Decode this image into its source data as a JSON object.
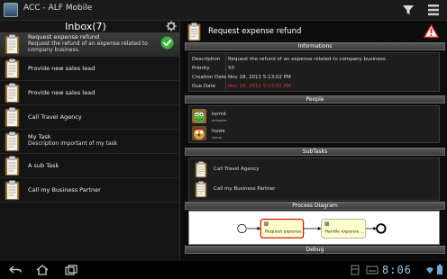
{
  "app": {
    "title": "ACC - ALF Mobile"
  },
  "inbox": {
    "title": "Inbox(7)",
    "tasks": [
      {
        "title": "Request expense refund",
        "desc": "Request the refund of an expense related to company business."
      },
      {
        "title": "Provide new sales lead",
        "desc": ""
      },
      {
        "title": "Provide new sales lead",
        "desc": ""
      },
      {
        "title": "Call Travel Agency",
        "desc": ""
      },
      {
        "title": "My Task",
        "desc": "Description important of my task"
      },
      {
        "title": "A sub Task",
        "desc": ""
      },
      {
        "title": "Call my Business Partner",
        "desc": ""
      }
    ]
  },
  "detail": {
    "title": "Request expense refund",
    "sections": {
      "informations": "Informations",
      "people": "People",
      "subtasks": "SubTasks",
      "process": "Process Diagram",
      "debug": "Debug"
    },
    "info": [
      {
        "label": "Description",
        "value": "Request the refund of an expense related to company business."
      },
      {
        "label": "Priority",
        "value": "50"
      },
      {
        "label": "Creation Date",
        "value": "Nov 18, 2011 5:13:02 PM"
      },
      {
        "label": "Due Date",
        "value": "Nov 18, 2011 5:13:02 PM"
      }
    ],
    "people": [
      {
        "name": "kermit",
        "role": "delegate"
      },
      {
        "name": "fozzie",
        "role": "owner"
      }
    ],
    "subtasks": [
      "Call Travel Agency",
      "Call my Business Partner"
    ],
    "diagram": {
      "nodes": [
        "Request expense...",
        "Handle expense ..."
      ]
    }
  },
  "status": {
    "time": "8:06"
  },
  "colors": {
    "due_date": "#dd3333",
    "accent_check": "#3fb33f",
    "warning": "#cc2222",
    "clock": "#9ec7e6"
  }
}
